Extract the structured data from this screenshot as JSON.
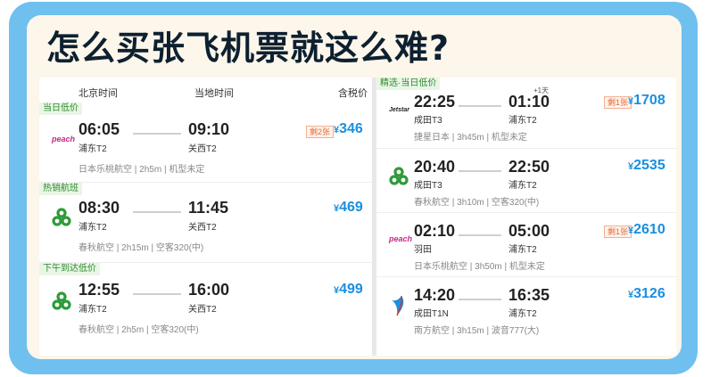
{
  "headline": "怎么买张飞机票就这么难?",
  "left": {
    "col_beijing_time": "北京时间",
    "col_local_time": "当地时间",
    "col_price_incl_tax": "含税价",
    "flights": [
      {
        "tag": "当日低价",
        "airline_logo": "peach",
        "dep_time": "06:05",
        "dep_airport": "浦东T2",
        "arr_time": "09:10",
        "arr_airport": "关西T2",
        "badge": "剩2张",
        "currency": "¥",
        "price": "346",
        "info": "日本乐桃航空 | 2h5m | 机型未定"
      },
      {
        "tag": "热销航班",
        "airline_logo": "spring",
        "dep_time": "08:30",
        "dep_airport": "浦东T2",
        "arr_time": "11:45",
        "arr_airport": "关西T2",
        "badge": "",
        "currency": "¥",
        "price": "469",
        "info": "春秋航空 | 2h15m | 空客320(中)"
      },
      {
        "tag": "下午到达低价",
        "airline_logo": "spring",
        "dep_time": "12:55",
        "dep_airport": "浦东T2",
        "arr_time": "16:00",
        "arr_airport": "关西T2",
        "badge": "",
        "currency": "¥",
        "price": "499",
        "info": "春秋航空 | 2h5m | 空客320(中)"
      }
    ]
  },
  "right": {
    "tag": "精选·当日低价",
    "flights": [
      {
        "airline_logo": "Jetstar",
        "dep_time": "22:25",
        "dep_airport": "成田T3",
        "arr_time": "01:10",
        "arr_airport": "浦东T2",
        "next_day": "+1天",
        "badge": "剩1张",
        "currency": "¥",
        "price": "1708",
        "info": "捷星日本 | 3h45m | 机型未定"
      },
      {
        "airline_logo": "spring",
        "dep_time": "20:40",
        "dep_airport": "成田T3",
        "arr_time": "22:50",
        "arr_airport": "浦东T2",
        "next_day": "",
        "badge": "",
        "currency": "¥",
        "price": "2535",
        "info": "春秋航空 | 3h10m | 空客320(中)"
      },
      {
        "airline_logo": "peach",
        "dep_time": "02:10",
        "dep_airport": "羽田",
        "arr_time": "05:00",
        "arr_airport": "浦东T2",
        "next_day": "",
        "badge": "剩1张",
        "currency": "¥",
        "price": "2610",
        "info": "日本乐桃航空 | 3h50m | 机型未定"
      },
      {
        "airline_logo": "china-southern",
        "dep_time": "14:20",
        "dep_airport": "成田T1N",
        "arr_time": "16:35",
        "arr_airport": "浦东T2",
        "next_day": "",
        "badge": "",
        "currency": "¥",
        "price": "3126",
        "info": "南方航空 | 3h15m | 波音777(大)"
      }
    ]
  },
  "colors": {
    "frame": "#6fc0ef",
    "price": "#1a8fe0",
    "tag_bg": "#e9f6e6",
    "tag_text": "#2e8b2e",
    "badge": "#e06a3a"
  }
}
